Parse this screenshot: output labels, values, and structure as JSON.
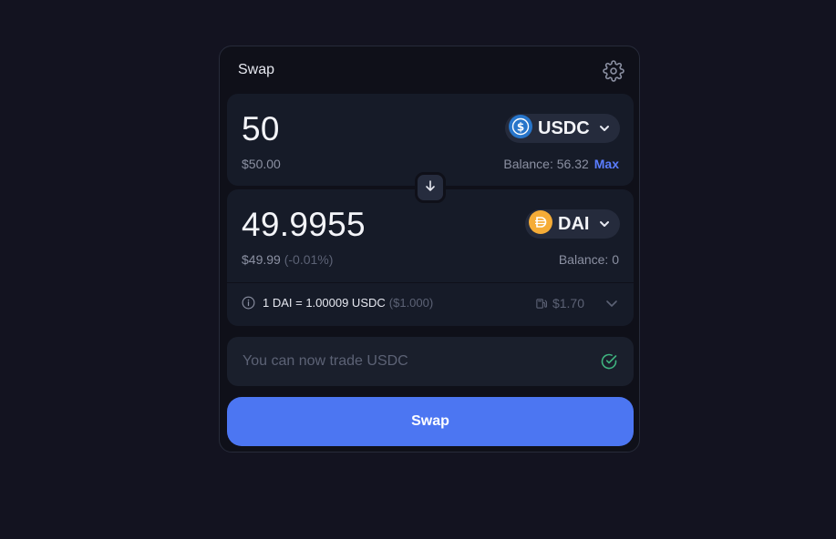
{
  "header": {
    "title": "Swap",
    "settings_icon": "gear-icon"
  },
  "from": {
    "amount": "50",
    "usd_value": "$50.00",
    "token": {
      "symbol": "USDC",
      "icon": "usdc-icon",
      "color": "#2775ca"
    },
    "balance_label": "Balance: 56.32",
    "max_label": "Max"
  },
  "flip_icon": "arrow-down-icon",
  "to": {
    "amount": "49.9955",
    "usd_value": "$49.99",
    "price_impact": "(-0.01%)",
    "token": {
      "symbol": "DAI",
      "icon": "dai-icon",
      "color": "#f5ac37"
    },
    "balance_label": "Balance: 0"
  },
  "rate": {
    "text": "1 DAI = 1.00009 USDC",
    "usd": "($1.000)",
    "gas_fee": "$1.70"
  },
  "notice": {
    "text": "You can now trade USDC",
    "icon": "check-circle-icon",
    "color": "#3fb37f"
  },
  "swap_button": {
    "label": "Swap",
    "color": "#4c76f2"
  }
}
